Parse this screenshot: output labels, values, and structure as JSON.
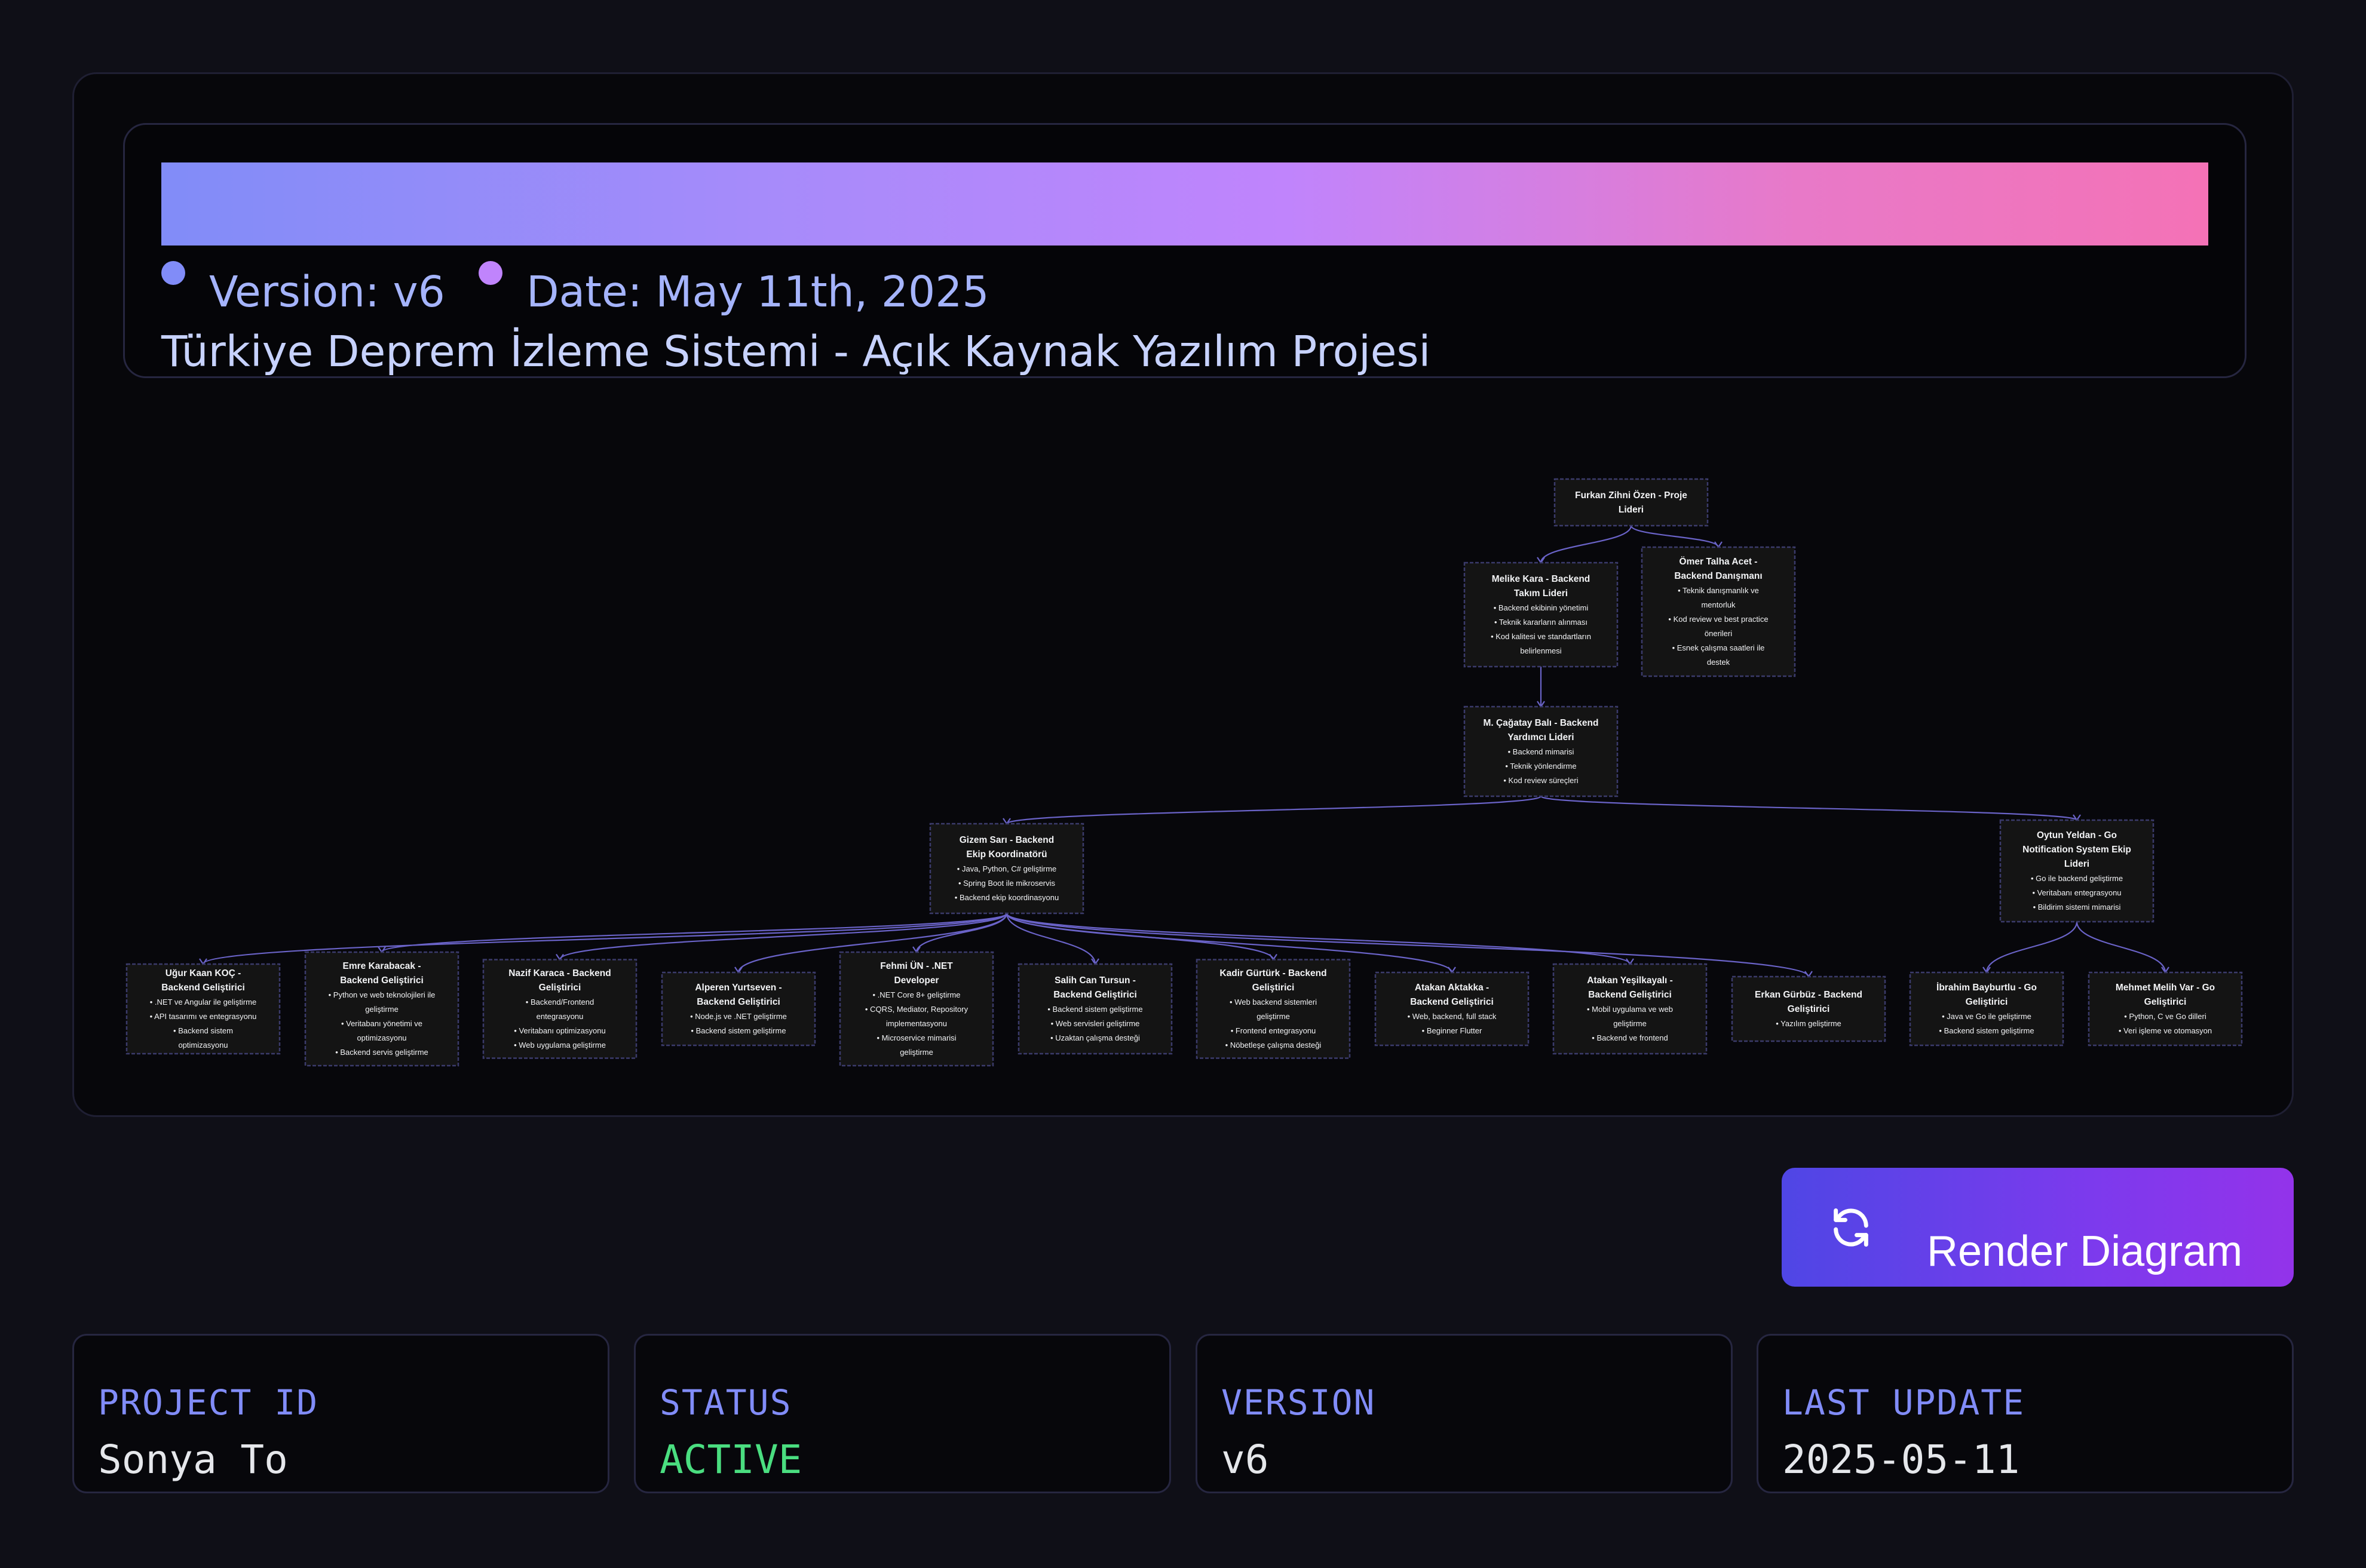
{
  "header": {
    "version_label": "Version: v6",
    "date_label": "Date: May 11th, 2025",
    "title": "Türkiye Deprem İzleme Sistemi - Açık Kaynak Yazılım Projesi"
  },
  "colors": {
    "accent": "#818cf8",
    "accent_pink": "#c084fc",
    "status_active": "#4ade80",
    "node_fill": "#141414",
    "node_border": "#3a3a6a",
    "edge": "#6a63c8"
  },
  "diagram": {
    "nodes": [
      {
        "id": "furkan",
        "lines": [
          "Furkan Zihni Özen - Proje",
          "Lideri"
        ]
      },
      {
        "id": "melike",
        "lines": [
          "Melike Kara - Backend",
          "Takım Lideri",
          "• Backend ekibinin yönetimi",
          "• Teknik kararların alınması",
          "• Kod kalitesi ve standartların",
          "belirlenmesi"
        ]
      },
      {
        "id": "omer",
        "lines": [
          "Ömer Talha Acet -",
          "Backend Danışmanı",
          "• Teknik danışmanlık ve",
          "mentorluk",
          "• Kod review ve best practice",
          "önerileri",
          "• Esnek çalışma saatleri ile",
          "destek"
        ]
      },
      {
        "id": "cagatay",
        "lines": [
          "M. Çağatay Balı - Backend",
          "Yardımcı Lideri",
          "• Backend mimarisi",
          "• Teknik yönlendirme",
          "• Kod review süreçleri"
        ]
      },
      {
        "id": "gizem",
        "lines": [
          "Gizem Sarı - Backend",
          "Ekip Koordinatörü",
          "• Java, Python, C# geliştirme",
          "• Spring Boot ile mikroservis",
          "• Backend ekip koordinasyonu"
        ]
      },
      {
        "id": "oytun",
        "lines": [
          "Oytun Yeldan - Go",
          "Notification System Ekip",
          "Lideri",
          "• Go ile backend geliştirme",
          "• Veritabanı entegrasyonu",
          "• Bildirim sistemi mimarisi"
        ]
      },
      {
        "id": "ugur",
        "lines": [
          "Uğur Kaan KOÇ -",
          "Backend Geliştirici",
          "• .NET ve Angular ile geliştirme",
          "• API tasarımı ve entegrasyonu",
          "• Backend sistem",
          "optimizasyonu"
        ]
      },
      {
        "id": "emre",
        "lines": [
          "Emre Karabacak -",
          "Backend Geliştirici",
          "• Python ve web teknolojileri ile",
          "geliştirme",
          "• Veritabanı yönetimi ve",
          "optimizasyonu",
          "• Backend servis geliştirme"
        ]
      },
      {
        "id": "nazif",
        "lines": [
          "Nazif Karaca - Backend",
          "Geliştirici",
          "• Backend/Frontend",
          "entegrasyonu",
          "• Veritabanı optimizasyonu",
          "• Web uygulama geliştirme"
        ]
      },
      {
        "id": "alperen",
        "lines": [
          "Alperen Yurtseven -",
          "Backend Geliştirici",
          "• Node.js ve .NET geliştirme",
          "• Backend sistem geliştirme"
        ]
      },
      {
        "id": "fehmi",
        "lines": [
          "Fehmi ÜN - .NET",
          "Developer",
          "• .NET Core 8+ geliştirme",
          "• CQRS, Mediator, Repository",
          "implementasyonu",
          "• Microservice mimarisi",
          "geliştirme"
        ]
      },
      {
        "id": "salih",
        "lines": [
          "Salih Can Tursun -",
          "Backend Geliştirici",
          "• Backend sistem geliştirme",
          "• Web servisleri geliştirme",
          "• Uzaktan çalışma desteği"
        ]
      },
      {
        "id": "kadir",
        "lines": [
          "Kadir Gürtürk - Backend",
          "Geliştirici",
          "• Web backend sistemleri",
          "geliştirme",
          "• Frontend entegrasyonu",
          "• Nöbetleşe çalışma desteği"
        ]
      },
      {
        "id": "atakan_a",
        "lines": [
          "Atakan Aktakka -",
          "Backend Geliştirici",
          "• Web, backend, full stack",
          "• Beginner Flutter"
        ]
      },
      {
        "id": "atakan_y",
        "lines": [
          "Atakan Yeşilkayalı -",
          "Backend Geliştirici",
          "• Mobil uygulama ve web",
          "geliştirme",
          "• Backend ve frontend"
        ]
      },
      {
        "id": "erkan",
        "lines": [
          "Erkan Gürbüz - Backend",
          "Geliştirici",
          "• Yazılım geliştirme"
        ]
      },
      {
        "id": "ibrahim",
        "lines": [
          "İbrahim Bayburtlu - Go",
          "Geliştirici",
          "• Java ve Go ile geliştirme",
          "• Backend sistem geliştirme"
        ]
      },
      {
        "id": "mehmet",
        "lines": [
          "Mehmet Melih Var - Go",
          "Geliştirici",
          "• Python, C ve Go dilleri",
          "• Veri işleme ve otomasyon"
        ]
      }
    ],
    "edges": [
      [
        "furkan",
        "melike"
      ],
      [
        "furkan",
        "omer"
      ],
      [
        "melike",
        "cagatay"
      ],
      [
        "cagatay",
        "gizem"
      ],
      [
        "cagatay",
        "oytun"
      ],
      [
        "gizem",
        "ugur"
      ],
      [
        "gizem",
        "emre"
      ],
      [
        "gizem",
        "nazif"
      ],
      [
        "gizem",
        "alperen"
      ],
      [
        "gizem",
        "fehmi"
      ],
      [
        "gizem",
        "salih"
      ],
      [
        "gizem",
        "kadir"
      ],
      [
        "gizem",
        "atakan_a"
      ],
      [
        "gizem",
        "atakan_y"
      ],
      [
        "gizem",
        "erkan"
      ],
      [
        "oytun",
        "ibrahim"
      ],
      [
        "oytun",
        "mehmet"
      ]
    ]
  },
  "render_button": {
    "label": "Render Diagram",
    "icon": "refresh-icon"
  },
  "stats": [
    {
      "label": "PROJECT ID",
      "value": "Sonya To"
    },
    {
      "label": "STATUS",
      "value": "ACTIVE"
    },
    {
      "label": "VERSION",
      "value": "v6"
    },
    {
      "label": "LAST UPDATE",
      "value": "2025-05-11"
    }
  ]
}
